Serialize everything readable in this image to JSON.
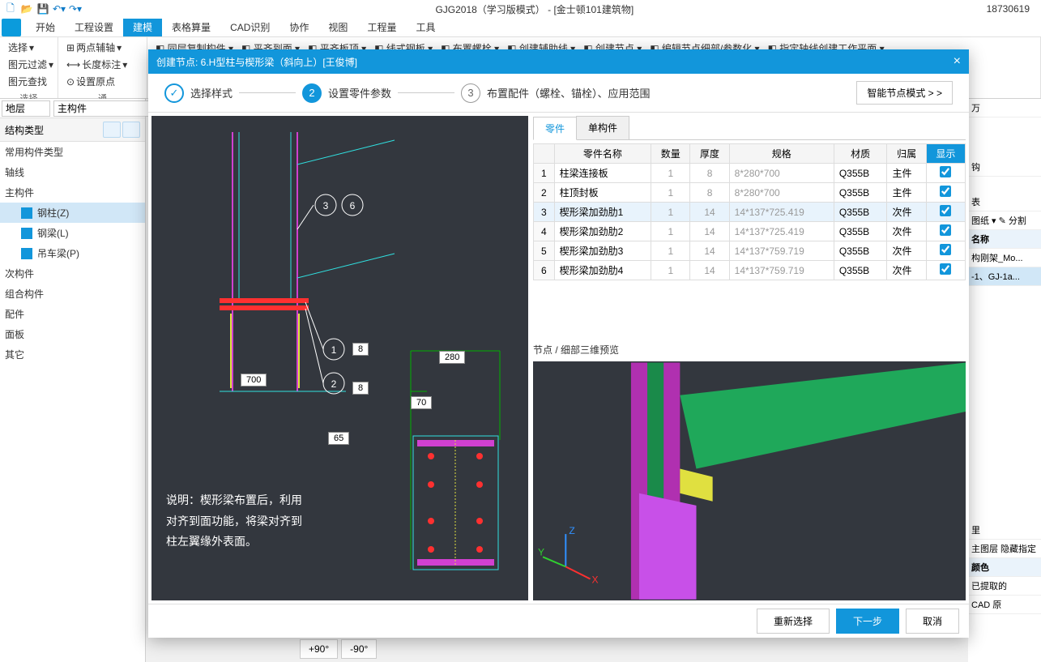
{
  "app": {
    "title": "GJG2018（学习版模式） - [金士顿101建筑物]",
    "user": "18730619"
  },
  "menu": {
    "items": [
      "开始",
      "工程设置",
      "建模",
      "表格算量",
      "CAD识别",
      "协作",
      "视图",
      "工程量",
      "工具"
    ],
    "active": 2
  },
  "ribbon": {
    "g1": {
      "a": "选择",
      "b": "图元过滤",
      "c": "图元查找",
      "label": "选择"
    },
    "g2": {
      "a": "两点辅轴",
      "b": "长度标注",
      "c": "设置原点",
      "label": "通"
    },
    "toprow": [
      "同层复制构件",
      "平齐到面",
      "平齐板顶",
      "线式钢板",
      "布置螺栓",
      "创建辅助线",
      "创建节点",
      "编辑节点细部/参数化",
      "指定轴线创建工作平面"
    ]
  },
  "left": {
    "combo1": "地层",
    "combo2": "主构件",
    "header": "结构类型",
    "section": "常用构件类型",
    "groups": [
      "轴线",
      "主构件",
      "次构件",
      "组合构件",
      "配件",
      "面板",
      "其它"
    ],
    "items": [
      "钢柱(Z)",
      "钢梁(L)",
      "吊车梁(P)"
    ]
  },
  "right": {
    "r1": "万",
    "r2": "钩",
    "r3": "表",
    "r4": "图纸 ▾  ✎ 分割",
    "r5": "名称",
    "r6": "构刚架_Mo...",
    "r7": "-1、GJ-1a...",
    "r8": "里",
    "r9": "主图层 隐藏指定",
    "r10": "颜色",
    "r11": "已提取的",
    "r12": "CAD 原"
  },
  "modal": {
    "title": "创建节点: 6.H型柱与楔形梁（斜向上）[王俊博]",
    "steps": {
      "s1": "选择样式",
      "s2": "设置零件参数",
      "s3": "布置配件（螺栓、锚栓）、应用范围"
    },
    "smart": "智能节点模式 > >",
    "note": "说明：楔形梁布置后，利用对齐到面功能，将梁对齐到柱左翼缘外表面。",
    "dims": {
      "d1": "8",
      "d2": "8",
      "d3": "700",
      "d4": "280",
      "d5": "70",
      "d6": "65"
    },
    "tabs": {
      "t1": "零件",
      "t2": "单构件"
    },
    "cols": [
      "",
      "零件名称",
      "数量",
      "厚度",
      "规格",
      "材质",
      "归属",
      "显示"
    ],
    "rows": [
      {
        "i": "1",
        "name": "柱梁连接板",
        "qty": "1",
        "th": "8",
        "spec": "8*280*700",
        "mat": "Q355B",
        "own": "主件"
      },
      {
        "i": "2",
        "name": "柱顶封板",
        "qty": "1",
        "th": "8",
        "spec": "8*280*700",
        "mat": "Q355B",
        "own": "主件"
      },
      {
        "i": "3",
        "name": "楔形梁加劲肋1",
        "qty": "1",
        "th": "14",
        "spec": "14*137*725.419",
        "mat": "Q355B",
        "own": "次件"
      },
      {
        "i": "4",
        "name": "楔形梁加劲肋2",
        "qty": "1",
        "th": "14",
        "spec": "14*137*725.419",
        "mat": "Q355B",
        "own": "次件"
      },
      {
        "i": "5",
        "name": "楔形梁加劲肋3",
        "qty": "1",
        "th": "14",
        "spec": "14*137*759.719",
        "mat": "Q355B",
        "own": "次件"
      },
      {
        "i": "6",
        "name": "楔形梁加劲肋4",
        "qty": "1",
        "th": "14",
        "spec": "14*137*759.719",
        "mat": "Q355B",
        "own": "次件"
      }
    ],
    "preview3d": "节点 / 细部三维预览",
    "footer": {
      "reset": "重新选择",
      "next": "下一步",
      "cancel": "取消"
    }
  },
  "angles": {
    "p": "+90°",
    "m": "-90°"
  }
}
